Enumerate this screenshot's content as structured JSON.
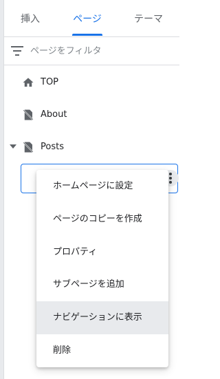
{
  "tabs": [
    {
      "label": "挿入",
      "active": false
    },
    {
      "label": "ページ",
      "active": true
    },
    {
      "label": "テーマ",
      "active": false
    }
  ],
  "filter": {
    "placeholder": "ページをフィルタ",
    "icon": "filter-list-icon"
  },
  "pages": [
    {
      "label": "TOP",
      "icon": "home-icon"
    },
    {
      "label": "About",
      "icon": "hidden-page-icon"
    },
    {
      "label": "Posts",
      "icon": "hidden-page-icon",
      "expanded": true
    }
  ],
  "context_menu": {
    "items": [
      {
        "label": "ホームページに設定"
      },
      {
        "label": "ページのコピーを作成"
      },
      {
        "label": "プロパティ"
      },
      {
        "label": "サブページを追加"
      },
      {
        "label": "ナビゲーションに表示",
        "highlighted": true
      },
      {
        "label": "削除"
      }
    ]
  },
  "colors": {
    "accent": "#1a73e8",
    "text": "#202124",
    "muted": "#5f6368",
    "divider": "#dadce0",
    "hover": "#e8eaed"
  }
}
